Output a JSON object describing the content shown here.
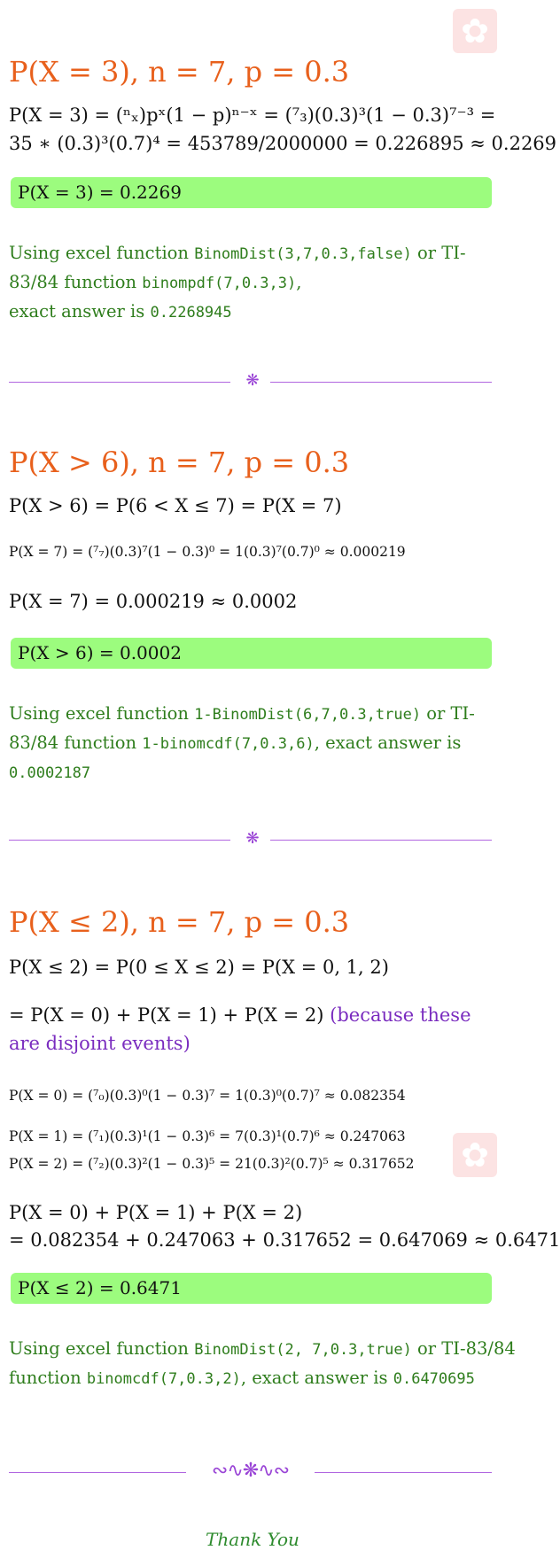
{
  "watermark_icon": "star-flower-icon",
  "s1": {
    "heading": "P(X = 3), n = 7, p = 0.3",
    "line1": "P(X = 3) = (ⁿₓ)pˣ(1 − p)ⁿ⁻ˣ = (⁷₃)(0.3)³(1 − 0.3)⁷⁻³ =",
    "line2": "35 ∗ (0.3)³(0.7)⁴ = 453789/2000000 = 0.226895 ≈ 0.2269",
    "answer": "P(X = 3) = 0.2269",
    "ex_a": "Using excel function ",
    "ex_code1": "BinomDist(3,7,0.3,false)",
    "ex_b": " or TI-83/84 function ",
    "ex_code2": "binompdf(7,0.3,3)",
    "ex_c": ",",
    "ex_d": "exact answer is ",
    "ex_val": "0.2268945"
  },
  "s2": {
    "heading": "P(X > 6), n = 7, p = 0.3",
    "line1": "P(X > 6) = P(6 < X ≤ 7) = P(X = 7)",
    "line2": "P(X = 7) = (⁷₇)(0.3)⁷(1 − 0.3)⁰ = 1(0.3)⁷(0.7)⁰ ≈ 0.000219",
    "line3": "P(X = 7) = 0.000219 ≈ 0.0002",
    "answer": "P(X > 6) = 0.0002",
    "ex_a": "Using excel function ",
    "ex_code1": "1-BinomDist(6,7,0.3,true)",
    "ex_b": " or TI-83/84 function ",
    "ex_code2": "1-binomcdf(7,0.3,6)",
    "ex_c": ", exact answer is ",
    "ex_val": "0.0002187"
  },
  "s3": {
    "heading": "P(X ≤ 2), n = 7, p = 0.3",
    "line1": "P(X ≤ 2) = P(0 ≤ X ≤ 2) = P(X = 0, 1, 2)",
    "line2": "= P(X = 0) + P(X = 1) + P(X = 2)",
    "line2_note": " (because these are disjoint events)",
    "line3": "P(X = 0) = (⁷₀)(0.3)⁰(1 − 0.3)⁷ = 1(0.3)⁰(0.7)⁷ ≈ 0.082354",
    "line4": "P(X = 1) = (⁷₁)(0.3)¹(1 − 0.3)⁶ = 7(0.3)¹(0.7)⁶ ≈ 0.247063",
    "line5": "P(X = 2) = (⁷₂)(0.3)²(1 − 0.3)⁵ = 21(0.3)²(0.7)⁵ ≈ 0.317652",
    "line6": "P(X = 0) + P(X = 1) + P(X = 2)",
    "line7": "= 0.082354 + 0.247063 + 0.317652 = 0.647069 ≈ 0.6471",
    "answer": "P(X ≤ 2) = 0.6471",
    "ex_a": "Using excel function ",
    "ex_code1": "BinomDist(2, 7,0.3,true)",
    "ex_b": " or TI-83/84 function ",
    "ex_code2": "binomcdf(7,0.3,2)",
    "ex_c": ", exact answer is ",
    "ex_val": "0.6470695"
  },
  "divider_icon": "❋",
  "flourish": "∾∿❋∿∾",
  "thanks": "Thank You",
  "colors": {
    "heading": "#e8601c",
    "answer_bg": "#9cfc7e",
    "excel_text": "#2e7d1c",
    "divider": "#b066e0"
  }
}
